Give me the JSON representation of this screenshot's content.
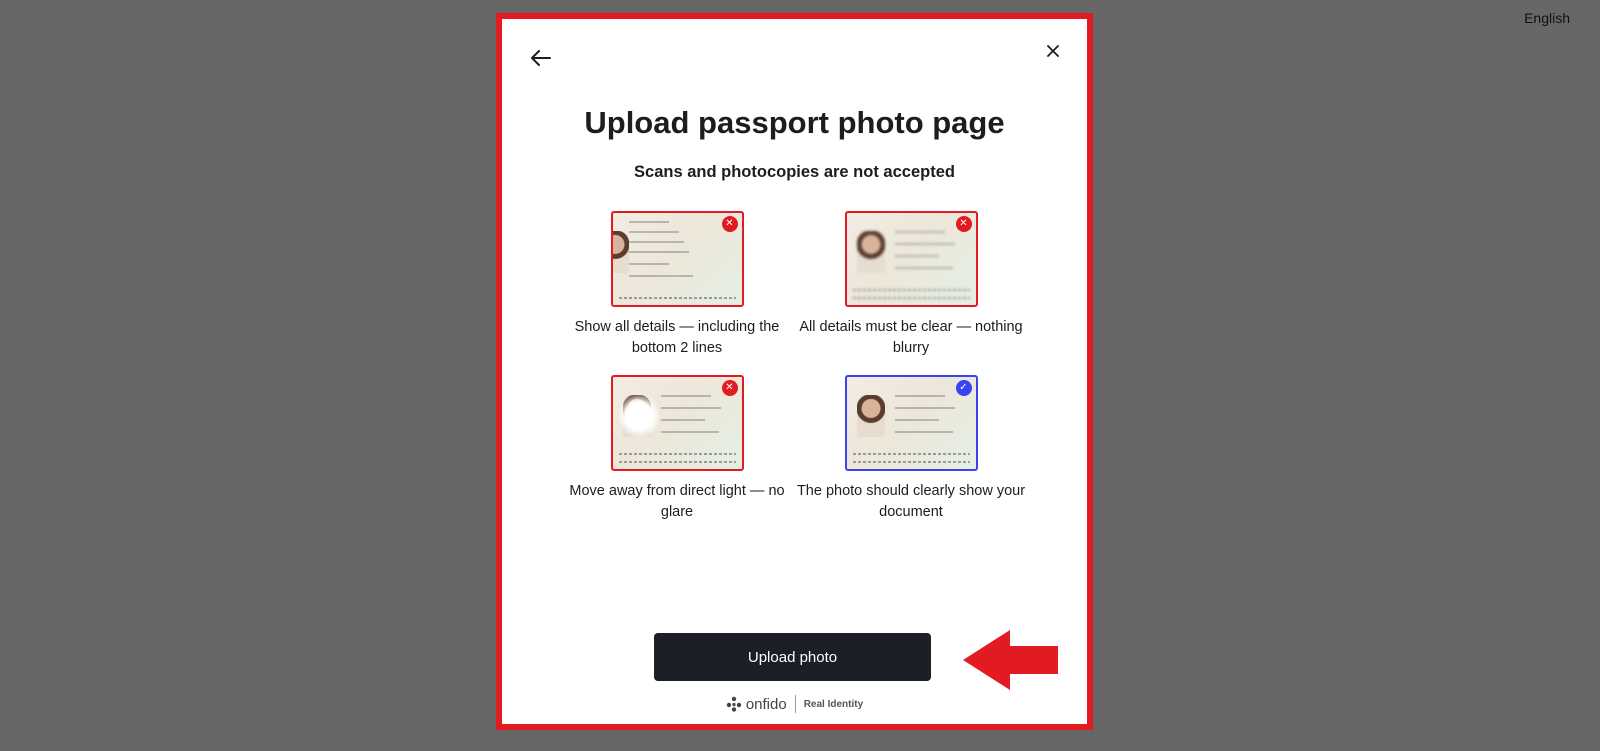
{
  "language": "English",
  "modal": {
    "title": "Upload passport photo page",
    "subtitle": "Scans and photocopies are not accepted",
    "tips": [
      {
        "caption": "Show all details — including the bottom 2 lines",
        "status": "bad"
      },
      {
        "caption": "All details must be clear — nothing blurry",
        "status": "bad"
      },
      {
        "caption": "Move away from direct light — no glare",
        "status": "bad"
      },
      {
        "caption": "The photo should clearly show your document",
        "status": "good"
      }
    ],
    "upload_button": "Upload photo"
  },
  "footer": {
    "brand": "onfido",
    "tagline": "Real Identity"
  },
  "icons": {
    "back": "arrow-left-icon",
    "close": "close-icon",
    "invalid": "x-circle-icon",
    "valid": "check-circle-icon",
    "annotation": "arrow-pointer-icon"
  },
  "colors": {
    "highlight": "#e21b22",
    "accent": "#3b43f0",
    "button": "#1c1f26",
    "backdrop": "#676767"
  }
}
